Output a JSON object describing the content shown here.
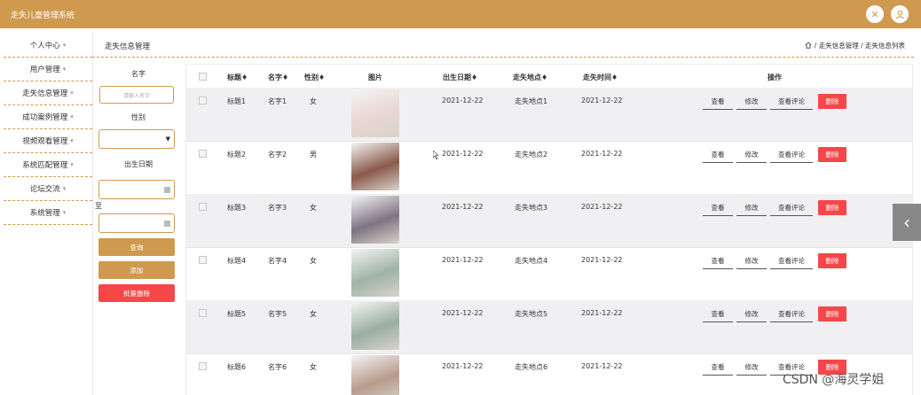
{
  "app": {
    "title": "走失儿童管理系统"
  },
  "header_icons": [
    "close-icon",
    "user-icon"
  ],
  "sidebar": {
    "items": [
      {
        "label": "个人中心"
      },
      {
        "label": "用户管理"
      },
      {
        "label": "走失信息管理"
      },
      {
        "label": "成功案例管理"
      },
      {
        "label": "视频观看管理"
      },
      {
        "label": "系统匹配管理"
      },
      {
        "label": "论坛交流"
      },
      {
        "label": "系统管理"
      }
    ],
    "caret": "▾"
  },
  "breadcrumb": {
    "page_title": "走失信息管理",
    "path": "/ 走失信息管理 / 走失信息列表"
  },
  "filter": {
    "name_label": "名字",
    "name_placeholder": "请输入名字",
    "gender_label": "性别",
    "birth_label": "出生日期",
    "to_label": "至",
    "query_btn": "查询",
    "add_btn": "添加",
    "batch_delete_btn": "批量删除"
  },
  "table": {
    "headers": {
      "title": "标题♦",
      "name": "名字♦",
      "gender": "性别♦",
      "photo": "图片",
      "birth": "出生日期♦",
      "place": "走失地点♦",
      "time": "走失时间♦",
      "ops": "操作"
    },
    "actions": {
      "view": "查看",
      "edit": "修改",
      "comments": "查看评论",
      "delete": "删除"
    },
    "rows": [
      {
        "title": "标题1",
        "name": "名字1",
        "gender": "女",
        "birth": "2021-12-22",
        "place": "走失地点1",
        "time": "2021-12-22",
        "photo_color": "#e9d6d2"
      },
      {
        "title": "标题2",
        "name": "名字2",
        "gender": "男",
        "birth": "2021-12-22",
        "place": "走失地点2",
        "time": "2021-12-22",
        "photo_color": "#8a5a4a"
      },
      {
        "title": "标题3",
        "name": "名字3",
        "gender": "女",
        "birth": "2021-12-22",
        "place": "走失地点3",
        "time": "2021-12-22",
        "photo_color": "#7f7480"
      },
      {
        "title": "标题4",
        "name": "名字4",
        "gender": "女",
        "birth": "2021-12-22",
        "place": "走失地点4",
        "time": "2021-12-22",
        "photo_color": "#9fb3a6"
      },
      {
        "title": "标题5",
        "name": "名字5",
        "gender": "女",
        "birth": "2021-12-22",
        "place": "走失地点5",
        "time": "2021-12-22",
        "photo_color": "#9aaea2"
      },
      {
        "title": "标题6",
        "name": "名字6",
        "gender": "女",
        "birth": "2021-12-22",
        "place": "走失地点6",
        "time": "2021-12-22",
        "photo_color": "#b79b8c"
      }
    ]
  },
  "watermark": "CSDN @海灵学姐",
  "colors": {
    "accent": "#cf9a4f",
    "danger": "#f54749"
  }
}
